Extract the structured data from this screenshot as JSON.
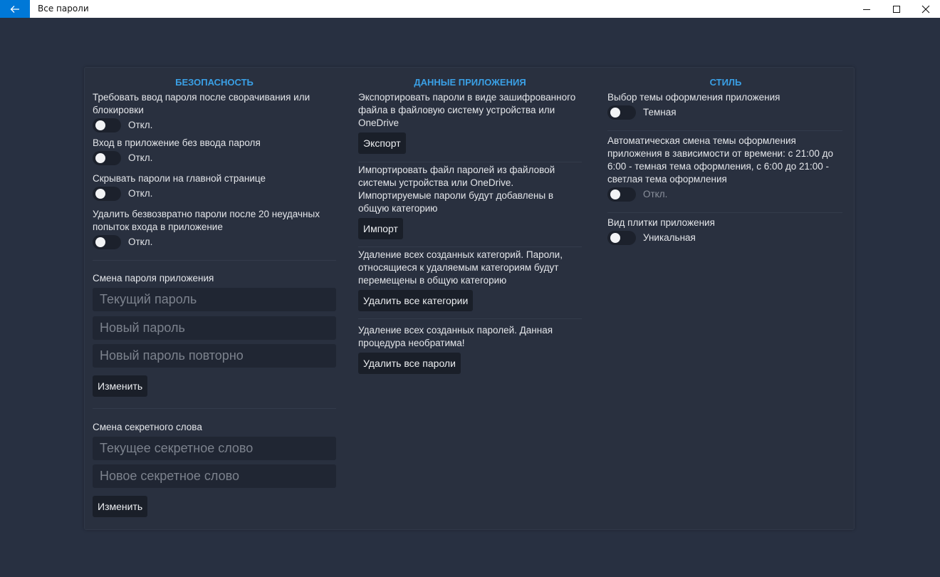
{
  "window": {
    "title": "Все пароли"
  },
  "security": {
    "header": "БЕЗОПАСНОСТЬ",
    "lock_label": "Требовать ввод пароля после сворачивания или блокировки",
    "lock_state": "Откл.",
    "nopass_label": "Вход в приложение без ввода пароля",
    "nopass_state": "Откл.",
    "hide_label": "Скрывать пароли на главной странице",
    "hide_state": "Откл.",
    "wipe_label": "Удалить безвозвратно пароли после 20 неудачных попыток входа в приложение",
    "wipe_state": "Откл.",
    "change_password_label": "Смена пароля приложения",
    "current_password_placeholder": "Текущий пароль",
    "new_password_placeholder": "Новый пароль",
    "repeat_password_placeholder": "Новый пароль повторно",
    "change_password_button": "Изменить",
    "change_secret_label": "Смена секретного слова",
    "current_secret_placeholder": "Текущее секретное слово",
    "new_secret_placeholder": "Новое секретное слово",
    "change_secret_button": "Изменить"
  },
  "app_data": {
    "header": "ДАННЫЕ ПРИЛОЖЕНИЯ",
    "export_text": "Экспортировать пароли в виде зашифрованного файла в файловую систему устройства или OneDrive",
    "export_button": "Экспорт",
    "import_text": "Импортировать файл паролей из файловой системы устройства или OneDrive. Импортируемые пароли будут добавлены в общую категорию",
    "import_button": "Импорт",
    "delete_categories_text": "Удаление всех созданных категорий. Пароли, относящиеся к удаляемым категориям будут перемещены в общую категорию",
    "delete_categories_button": "Удалить все категории",
    "delete_passwords_text": "Удаление всех созданных паролей. Данная процедура необратима!",
    "delete_passwords_button": "Удалить все пароли"
  },
  "style": {
    "header": "СТИЛЬ",
    "theme_label": "Выбор темы оформления приложения",
    "theme_state": "Темная",
    "auto_theme_label": "Автоматическая смена темы оформления приложения в зависимости от времени: с 21:00 до 6:00 - темная тема оформления, с 6:00 до 21:00 - светлая тема оформления",
    "auto_theme_state": "Откл.",
    "tile_label": "Вид плитки приложения",
    "tile_state": "Уникальная"
  },
  "colors": {
    "background": "#283041",
    "accent": "#3aa0e6",
    "titlebar_accent": "#0078d7"
  }
}
